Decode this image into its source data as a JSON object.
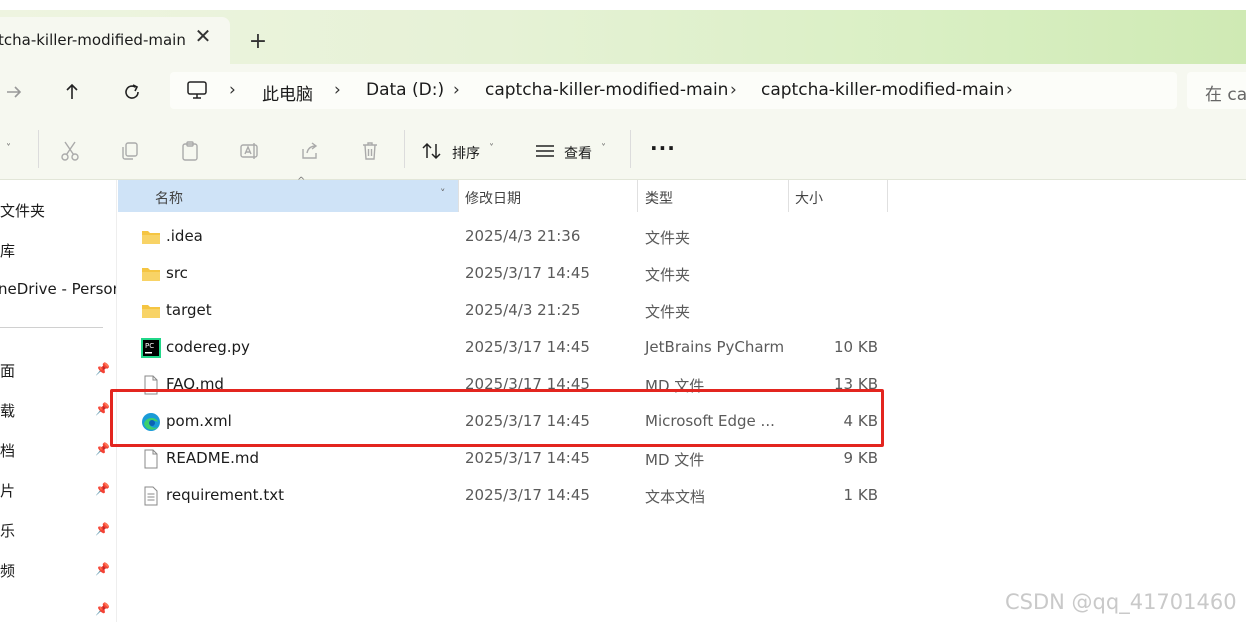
{
  "tab": {
    "title": "tcha-killer-modified-main",
    "close_glyph": "✕",
    "new_glyph": "+"
  },
  "breadcrumb": {
    "items": [
      "此电脑",
      "Data (D:)",
      "captcha-killer-modified-main",
      "captcha-killer-modified-main"
    ],
    "separator": "›"
  },
  "search": {
    "placeholder": "在 ca"
  },
  "toolbar": {
    "new_caret": "˅",
    "sort_label": "排序",
    "view_label": "查看",
    "more_glyph": "···"
  },
  "sidebar": {
    "items": [
      {
        "label": "文件夹",
        "pinned": false
      },
      {
        "label": "库",
        "pinned": false
      },
      {
        "label": "neDrive - Person",
        "pinned": false
      },
      {
        "label": "面",
        "pinned": true
      },
      {
        "label": "载",
        "pinned": true
      },
      {
        "label": "档",
        "pinned": true
      },
      {
        "label": "片",
        "pinned": true
      },
      {
        "label": "乐",
        "pinned": true
      },
      {
        "label": "频",
        "pinned": true
      },
      {
        "label": "",
        "pinned": true
      }
    ],
    "pin_glyph": "📌"
  },
  "columns": {
    "name": "名称",
    "date": "修改日期",
    "type": "类型",
    "size": "大小"
  },
  "files": [
    {
      "name": ".idea",
      "date": "2025/4/3 21:36",
      "type": "文件夹",
      "size": "",
      "icon": "folder-icon"
    },
    {
      "name": "src",
      "date": "2025/3/17 14:45",
      "type": "文件夹",
      "size": "",
      "icon": "folder-icon"
    },
    {
      "name": "target",
      "date": "2025/4/3 21:25",
      "type": "文件夹",
      "size": "",
      "icon": "folder-icon"
    },
    {
      "name": "codereg.py",
      "date": "2025/3/17 14:45",
      "type": "JetBrains PyCharm",
      "size": "10 KB",
      "icon": "pycharm-icon"
    },
    {
      "name": "FAQ.md",
      "date": "2025/3/17 14:45",
      "type": "MD 文件",
      "size": "13 KB",
      "icon": "file-icon"
    },
    {
      "name": "pom.xml",
      "date": "2025/3/17 14:45",
      "type": "Microsoft Edge ...",
      "size": "4 KB",
      "icon": "edge-icon"
    },
    {
      "name": "README.md",
      "date": "2025/3/17 14:45",
      "type": "MD 文件",
      "size": "9 KB",
      "icon": "file-icon"
    },
    {
      "name": "requirement.txt",
      "date": "2025/3/17 14:45",
      "type": "文本文档",
      "size": "1 KB",
      "icon": "text-file-icon"
    }
  ],
  "watermark": "CSDN @qq_41701460",
  "colors": {
    "highlight": "#e3251f",
    "header_selected": "#cfe3f7",
    "folder": "#f5c542"
  }
}
